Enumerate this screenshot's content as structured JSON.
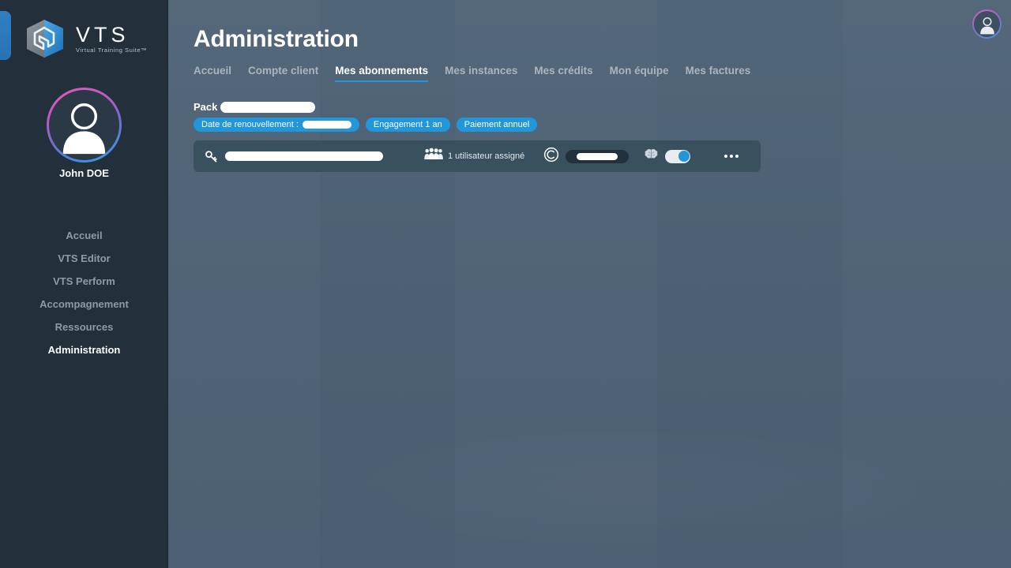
{
  "brand": {
    "name": "VTS",
    "tagline": "Virtual Training Suite™",
    "logo_icon": "vts-cube-logo"
  },
  "sidebar": {
    "user_name": "John DOE",
    "avatar_icon": "user-avatar-icon",
    "items": [
      {
        "label": "Accueil",
        "active": false
      },
      {
        "label": "VTS Editor",
        "active": false
      },
      {
        "label": "VTS Perform",
        "active": false
      },
      {
        "label": "Accompagnement",
        "active": false
      },
      {
        "label": "Ressources",
        "active": false
      },
      {
        "label": "Administration",
        "active": true
      }
    ]
  },
  "header": {
    "title": "Administration",
    "account_avatar_icon": "account-avatar-icon"
  },
  "tabs": [
    {
      "label": "Accueil",
      "active": false
    },
    {
      "label": "Compte client",
      "active": false
    },
    {
      "label": "Mes abonnements",
      "active": true
    },
    {
      "label": "Mes instances",
      "active": false
    },
    {
      "label": "Mes crédits",
      "active": false
    },
    {
      "label": "Mon équipe",
      "active": false
    },
    {
      "label": "Mes factures",
      "active": false
    }
  ],
  "pack": {
    "label": "Pack",
    "value_redacted": true
  },
  "badges": [
    {
      "label": "Date de renouvellement :",
      "has_redaction": true
    },
    {
      "label": "Engagement 1 an",
      "has_redaction": false
    },
    {
      "label": "Paiement annuel",
      "has_redaction": false
    }
  ],
  "subscription_card": {
    "key_icon": "key-icon",
    "license_redacted": true,
    "users_icon": "users-group-icon",
    "users_label": "1 utilisateur assigné",
    "credits_icon": "credits-circle-icon",
    "credits_redacted": true,
    "ai_icon": "brain-icon",
    "ai_toggle_on": true,
    "more_icon": "more-options-icon"
  },
  "colors": {
    "accent": "#2196d9",
    "sidebar_bg": "#232f3a",
    "main_bg": "#4f6375",
    "card_bg": "#39505e"
  }
}
